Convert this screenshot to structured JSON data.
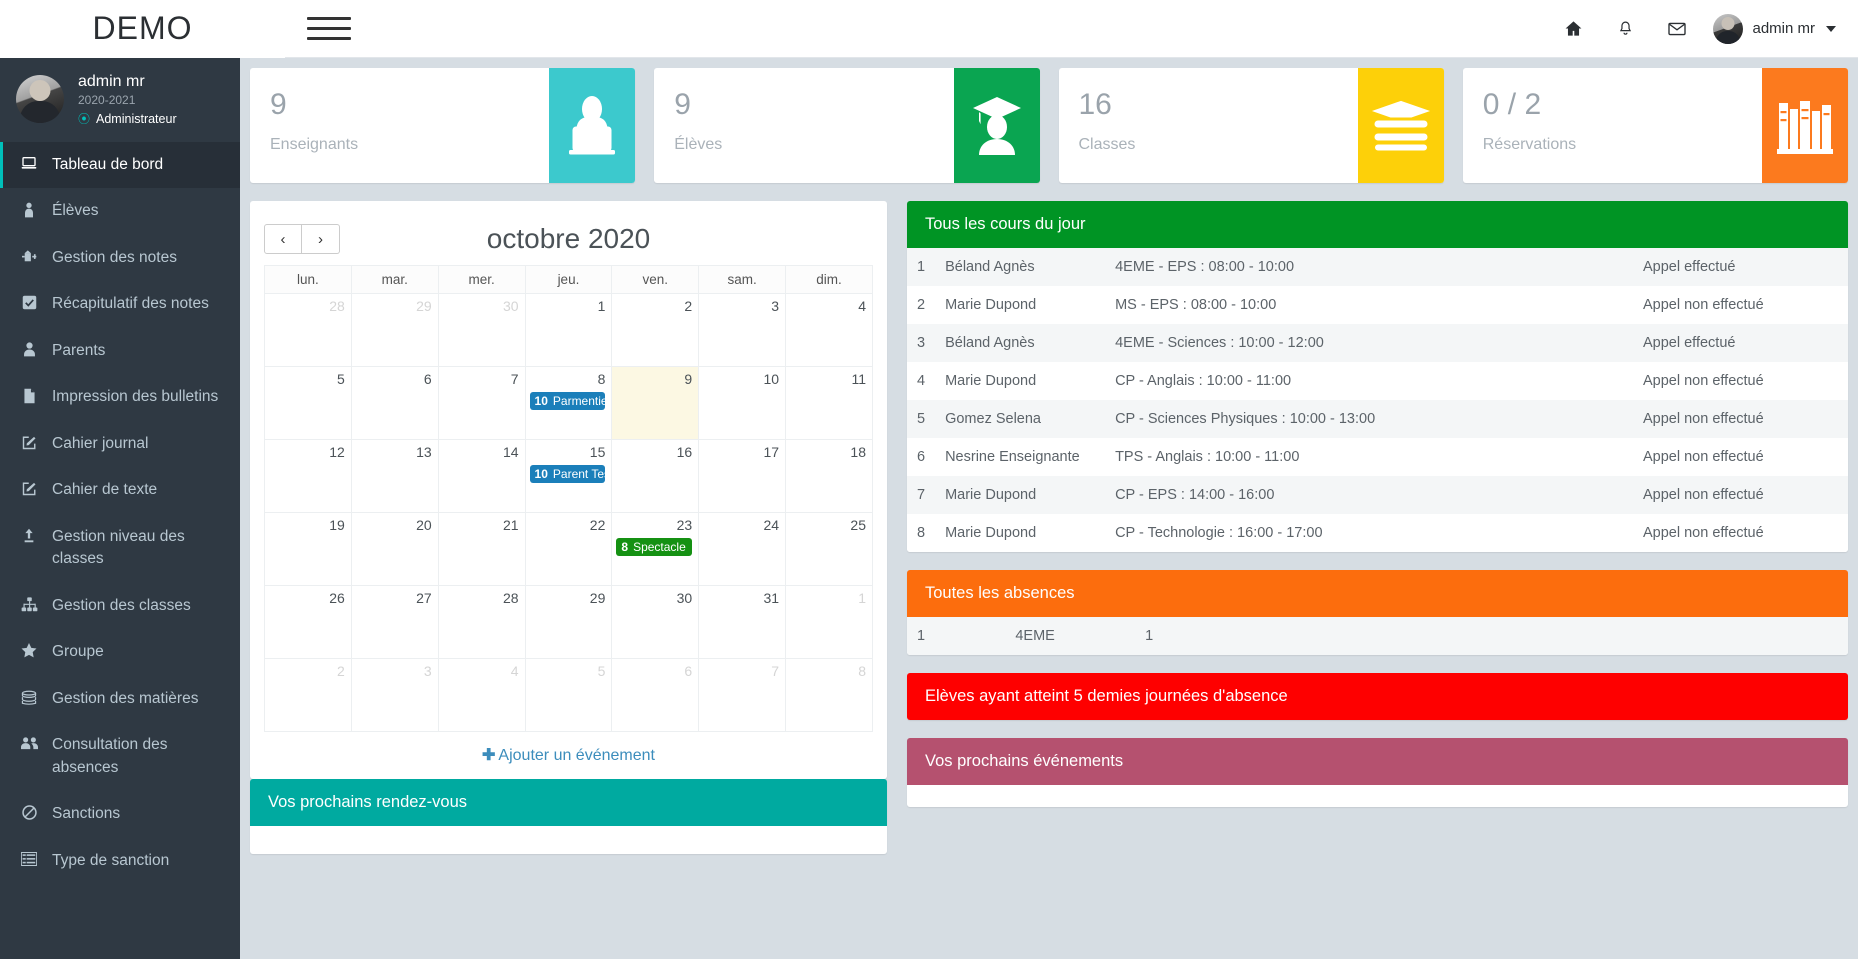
{
  "header": {
    "brand": "DEMO",
    "menu_toggle": "menu",
    "icons": [
      "home-icon",
      "bell-icon",
      "envelope-icon"
    ],
    "user_name": "admin mr"
  },
  "sidebar": {
    "user": {
      "name": "admin mr",
      "year": "2020-2021",
      "role": "Administrateur"
    },
    "items": [
      {
        "label": "Tableau de bord",
        "icon": "laptop-icon",
        "active": true
      },
      {
        "label": "Élèves",
        "icon": "student-icon",
        "active": false
      },
      {
        "label": "Gestion des notes",
        "icon": "notes-icon",
        "active": false
      },
      {
        "label": "Récapitulatif des notes",
        "icon": "checkbox-icon",
        "active": false
      },
      {
        "label": "Parents",
        "icon": "user-icon",
        "active": false
      },
      {
        "label": "Impression des bulletins",
        "icon": "file-icon",
        "active": false
      },
      {
        "label": "Cahier journal",
        "icon": "edit-icon",
        "active": false
      },
      {
        "label": "Cahier de texte",
        "icon": "edit-icon",
        "active": false
      },
      {
        "label": "Gestion niveau des classes",
        "icon": "level-up-icon",
        "active": false
      },
      {
        "label": "Gestion des classes",
        "icon": "sitemap-icon",
        "active": false
      },
      {
        "label": "Groupe",
        "icon": "star-icon",
        "active": false
      },
      {
        "label": "Gestion des matières",
        "icon": "books-icon",
        "active": false
      },
      {
        "label": "Consultation des absences",
        "icon": "group-icon",
        "active": false
      },
      {
        "label": "Sanctions",
        "icon": "ban-icon",
        "active": false
      },
      {
        "label": "Type de sanction",
        "icon": "list-icon",
        "active": false
      }
    ]
  },
  "stats": [
    {
      "value": "9",
      "label": "Enseignants",
      "icon": "teacher-icon",
      "color": "#3cc9cd"
    },
    {
      "value": "9",
      "label": "Élèves",
      "icon": "graduate-icon",
      "color": "#0aa551"
    },
    {
      "value": "16",
      "label": "Classes",
      "icon": "books-icon",
      "color": "#fdd009"
    },
    {
      "value": "0 / 2",
      "label": "Réservations",
      "icon": "library-icon",
      "color": "#fc7a1e"
    }
  ],
  "calendar": {
    "title": "octobre 2020",
    "prev_label": "‹",
    "next_label": "›",
    "day_headers": [
      "lun.",
      "mar.",
      "mer.",
      "jeu.",
      "ven.",
      "sam.",
      "dim."
    ],
    "weeks": [
      [
        {
          "day": "28",
          "other": true
        },
        {
          "day": "29",
          "other": true
        },
        {
          "day": "30",
          "other": true
        },
        {
          "day": "1"
        },
        {
          "day": "2"
        },
        {
          "day": "3"
        },
        {
          "day": "4"
        }
      ],
      [
        {
          "day": "5"
        },
        {
          "day": "6"
        },
        {
          "day": "7"
        },
        {
          "day": "8",
          "events": [
            {
              "badge": "10",
              "title": "Parmentier",
              "color": "blue"
            }
          ]
        },
        {
          "day": "9",
          "today": true
        },
        {
          "day": "10"
        },
        {
          "day": "11"
        }
      ],
      [
        {
          "day": "12"
        },
        {
          "day": "13"
        },
        {
          "day": "14"
        },
        {
          "day": "15",
          "events": [
            {
              "badge": "10",
              "title": "Parent Test",
              "color": "blue"
            }
          ]
        },
        {
          "day": "16"
        },
        {
          "day": "17"
        },
        {
          "day": "18"
        }
      ],
      [
        {
          "day": "19"
        },
        {
          "day": "20"
        },
        {
          "day": "21"
        },
        {
          "day": "22"
        },
        {
          "day": "23",
          "events": [
            {
              "badge": "8",
              "title": "Spectacle",
              "color": "green"
            }
          ]
        },
        {
          "day": "24"
        },
        {
          "day": "25"
        }
      ],
      [
        {
          "day": "26"
        },
        {
          "day": "27"
        },
        {
          "day": "28"
        },
        {
          "day": "29"
        },
        {
          "day": "30"
        },
        {
          "day": "31"
        },
        {
          "day": "1",
          "other": true
        }
      ],
      [
        {
          "day": "2",
          "other": true
        },
        {
          "day": "3",
          "other": true
        },
        {
          "day": "4",
          "other": true
        },
        {
          "day": "5",
          "other": true
        },
        {
          "day": "6",
          "other": true
        },
        {
          "day": "7",
          "other": true
        },
        {
          "day": "8",
          "other": true
        }
      ]
    ],
    "add_event_label": "Ajouter un événement",
    "add_event_plus": "✚"
  },
  "appointments_panel": {
    "title": "Vos prochains rendez-vous",
    "color": "#00aaa0"
  },
  "courses_panel": {
    "title": "Tous les cours du jour",
    "color": "#009424",
    "rows": [
      {
        "idx": "1",
        "teacher": "Béland Agnès",
        "course": "4EME - EPS : 08:00 - 10:00",
        "status": "Appel effectué",
        "done": true
      },
      {
        "idx": "2",
        "teacher": "Marie Dupond",
        "course": "MS - EPS : 08:00 - 10:00",
        "status": "Appel non effectué",
        "done": false
      },
      {
        "idx": "3",
        "teacher": "Béland Agnès",
        "course": "4EME - Sciences : 10:00 - 12:00",
        "status": "Appel effectué",
        "done": true
      },
      {
        "idx": "4",
        "teacher": "Marie Dupond",
        "course": "CP - Anglais : 10:00 - 11:00",
        "status": "Appel non effectué",
        "done": false
      },
      {
        "idx": "5",
        "teacher": "Gomez Selena",
        "course": "CP - Sciences Physiques : 10:00 - 13:00",
        "status": "Appel non effectué",
        "done": false
      },
      {
        "idx": "6",
        "teacher": "Nesrine Enseignante",
        "course": "TPS - Anglais : 10:00 - 11:00",
        "status": "Appel non effectué",
        "done": false
      },
      {
        "idx": "7",
        "teacher": "Marie Dupond",
        "course": "CP - EPS : 14:00 - 16:00",
        "status": "Appel non effectué",
        "done": false
      },
      {
        "idx": "8",
        "teacher": "Marie Dupond",
        "course": "CP - Technologie : 16:00 - 17:00",
        "status": "Appel non effectué",
        "done": false
      }
    ]
  },
  "absences_panel": {
    "title": "Toutes les absences",
    "color": "#fc6d0d",
    "rows": [
      {
        "idx": "1",
        "classe": "4EME",
        "count": "1"
      }
    ]
  },
  "alert_panel": {
    "title": "Elèves ayant atteint 5 demies journées d'absence",
    "color": "#fe0000"
  },
  "events_panel": {
    "title": "Vos prochains événements",
    "color": "#b5516f"
  }
}
